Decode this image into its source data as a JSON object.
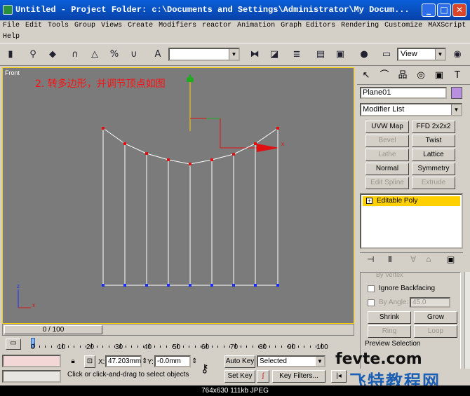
{
  "window": {
    "title": "Untitled     - Project Folder: c:\\Documents and Settings\\Administrator\\My Docum..."
  },
  "menu": {
    "row1": [
      "File",
      "Edit",
      "Tools",
      "Group",
      "Views",
      "Create",
      "Modifiers",
      "reactor",
      "Animation",
      "Graph Editors",
      "Rendering",
      "Customize",
      "MAXScript"
    ],
    "row2": [
      "Help"
    ]
  },
  "toolbar": {
    "selection_set": "",
    "view_combo": "View"
  },
  "viewport": {
    "label": "Front",
    "note": "2. 转多边形，并调节顶点如图",
    "axis_x": "x",
    "axis_z": "z"
  },
  "command_panel": {
    "object_name": "Plane01",
    "object_color": "#b98fe0",
    "modifier_list": "Modifier List",
    "buttons": [
      {
        "label": "UVW Map",
        "enabled": true
      },
      {
        "label": "FFD 2x2x2",
        "enabled": true
      },
      {
        "label": "Bevel",
        "enabled": false
      },
      {
        "label": "Twist",
        "enabled": true
      },
      {
        "label": "Lathe",
        "enabled": false
      },
      {
        "label": "Lattice",
        "enabled": true
      },
      {
        "label": "Normal",
        "enabled": true
      },
      {
        "label": "Symmetry",
        "enabled": true
      },
      {
        "label": "Edit Spline",
        "enabled": false
      },
      {
        "label": "Extrude",
        "enabled": false
      }
    ],
    "stack_item": "Editable Poly",
    "by_vertex": "By Vertex",
    "ignore_backfacing": "Ignore Backfacing",
    "by_angle": "By Angle:",
    "angle_value": "45.0",
    "shrink": "Shrink",
    "grow": "Grow",
    "ring": "Ring",
    "loop": "Loop",
    "preview_selection": "Preview Selection"
  },
  "timeline": {
    "slider": "0 / 100",
    "ticks": [
      "0",
      "10",
      "20",
      "30",
      "40",
      "50",
      "60",
      "70",
      "80",
      "90",
      "100"
    ]
  },
  "status": {
    "x_label": "X:",
    "x_value": "47.203mm",
    "y_label": "Y:",
    "y_value": "-0.0mm",
    "auto_key": "Auto Key",
    "set_key": "Set Key",
    "selected": "Selected",
    "key_filters": "Key Filters...",
    "prompt": "Click or click-and-drag to select objects"
  },
  "footer": "764x630  111kb  JPEG",
  "watermark": {
    "line1": "fevte.com",
    "line2": "飞特教程网"
  }
}
